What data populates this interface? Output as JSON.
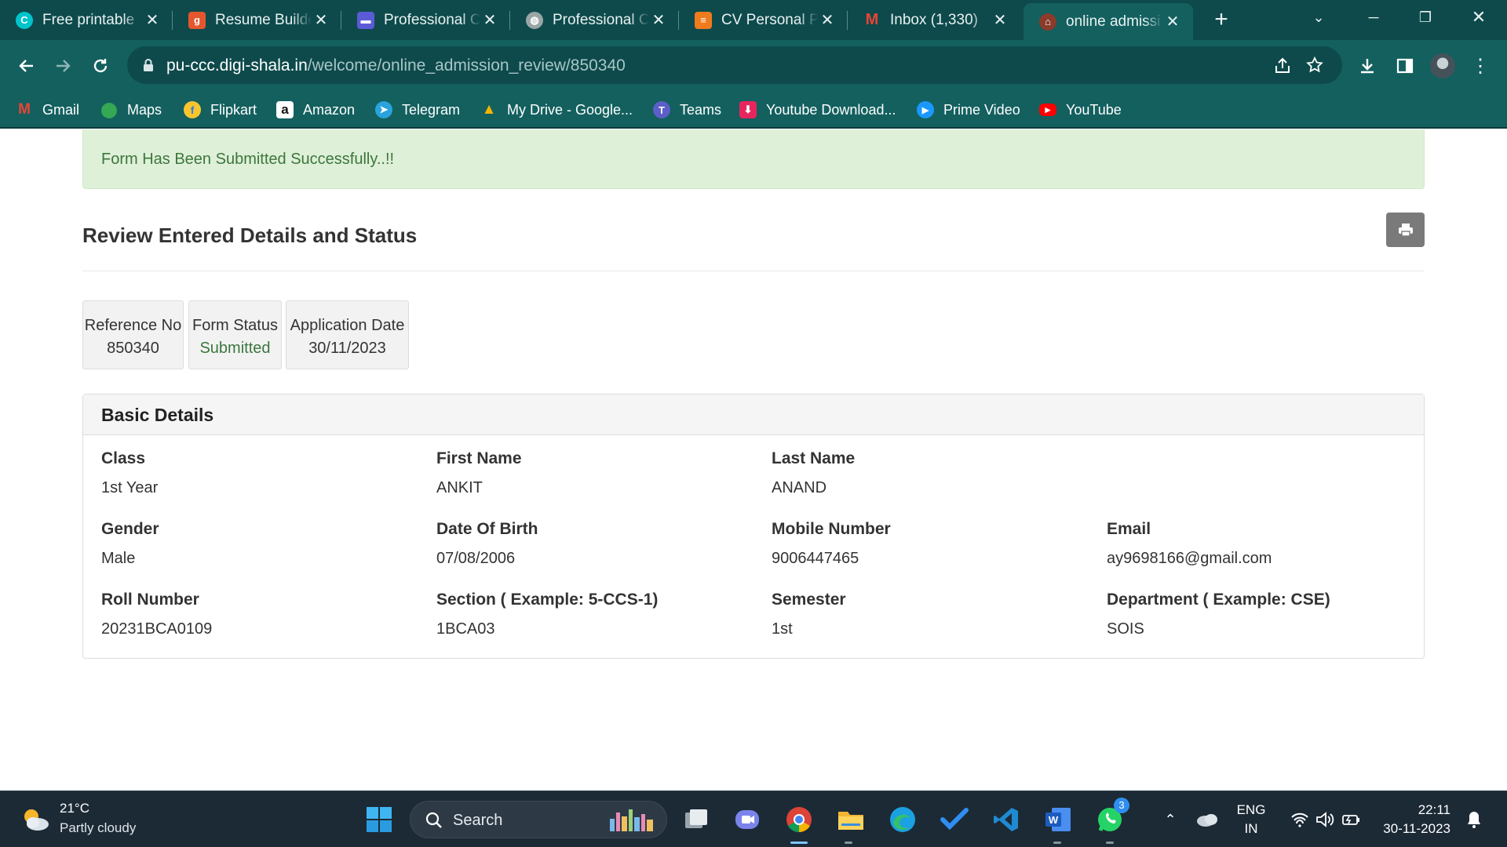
{
  "browser": {
    "tabs": [
      {
        "label": "Free printable",
        "icon": "canva-icon"
      },
      {
        "label": "Resume Builder",
        "icon": "g-icon"
      },
      {
        "label": "Professional C",
        "icon": "builder-icon"
      },
      {
        "label": "Professional C",
        "icon": "globe-icon"
      },
      {
        "label": "CV Personal Pr",
        "icon": "cv-icon"
      },
      {
        "label": "Inbox (1,330)",
        "icon": "gmail-icon"
      },
      {
        "label": "online admissi",
        "icon": "university-icon"
      }
    ],
    "url_host": "pu-ccc.digi-shala.in",
    "url_path": "/welcome/online_admission_review/850340",
    "bookmarks": [
      {
        "label": "Gmail"
      },
      {
        "label": "Maps"
      },
      {
        "label": "Flipkart"
      },
      {
        "label": "Amazon"
      },
      {
        "label": "Telegram"
      },
      {
        "label": "My Drive - Google..."
      },
      {
        "label": "Teams"
      },
      {
        "label": "Youtube Download..."
      },
      {
        "label": "Prime Video"
      },
      {
        "label": "YouTube"
      }
    ]
  },
  "page": {
    "alert": "Form Has Been Submitted Successfully..!!",
    "title": "Review Entered Details and Status",
    "stats": {
      "ref_label": "Reference No",
      "ref_value": "850340",
      "status_label": "Form Status",
      "status_value": "Submitted",
      "date_label": "Application Date",
      "date_value": "30/11/2023"
    },
    "panel_title": "Basic Details",
    "fields": {
      "class_label": "Class",
      "class_value": "1st Year",
      "first_name_label": "First Name",
      "first_name_value": "ANKIT",
      "last_name_label": "Last Name",
      "last_name_value": "ANAND",
      "gender_label": "Gender",
      "gender_value": "Male",
      "dob_label": "Date Of Birth",
      "dob_value": "07/08/2006",
      "mobile_label": "Mobile Number",
      "mobile_value": "9006447465",
      "email_label": "Email",
      "email_value": "ay9698166@gmail.com",
      "roll_label": "Roll Number",
      "roll_value": "20231BCA0109",
      "section_label": "Section ( Example: 5-CCS-1)",
      "section_value": "1BCA03",
      "semester_label": "Semester",
      "semester_value": "1st",
      "department_label": "Department ( Example: CSE)",
      "department_value": "SOIS"
    }
  },
  "taskbar": {
    "weather_temp": "21°C",
    "weather_desc": "Partly cloudy",
    "search": "Search",
    "whatsapp_badge": "3",
    "lang_top": "ENG",
    "lang_bottom": "IN",
    "time": "22:11",
    "date": "30-11-2023"
  },
  "colors": {
    "browser_frame": "#0e4a4c",
    "toolbar": "#13605f",
    "alert_bg": "#dff0d8",
    "alert_text": "#3c763d",
    "taskbar": "#1c2a36"
  }
}
